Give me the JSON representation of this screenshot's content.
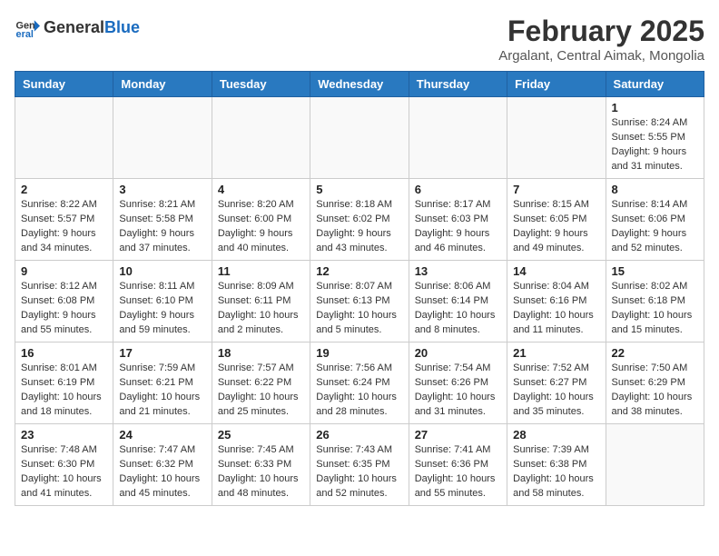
{
  "header": {
    "logo": {
      "general": "General",
      "blue": "Blue"
    },
    "title": "February 2025",
    "subtitle": "Argalant, Central Aimak, Mongolia"
  },
  "weekdays": [
    "Sunday",
    "Monday",
    "Tuesday",
    "Wednesday",
    "Thursday",
    "Friday",
    "Saturday"
  ],
  "weeks": [
    [
      {
        "day": null
      },
      {
        "day": null
      },
      {
        "day": null
      },
      {
        "day": null
      },
      {
        "day": null
      },
      {
        "day": null
      },
      {
        "day": "1",
        "sunrise": "8:24 AM",
        "sunset": "5:55 PM",
        "daylight": "9 hours and 31 minutes."
      }
    ],
    [
      {
        "day": "2",
        "sunrise": "8:22 AM",
        "sunset": "5:57 PM",
        "daylight": "9 hours and 34 minutes."
      },
      {
        "day": "3",
        "sunrise": "8:21 AM",
        "sunset": "5:58 PM",
        "daylight": "9 hours and 37 minutes."
      },
      {
        "day": "4",
        "sunrise": "8:20 AM",
        "sunset": "6:00 PM",
        "daylight": "9 hours and 40 minutes."
      },
      {
        "day": "5",
        "sunrise": "8:18 AM",
        "sunset": "6:02 PM",
        "daylight": "9 hours and 43 minutes."
      },
      {
        "day": "6",
        "sunrise": "8:17 AM",
        "sunset": "6:03 PM",
        "daylight": "9 hours and 46 minutes."
      },
      {
        "day": "7",
        "sunrise": "8:15 AM",
        "sunset": "6:05 PM",
        "daylight": "9 hours and 49 minutes."
      },
      {
        "day": "8",
        "sunrise": "8:14 AM",
        "sunset": "6:06 PM",
        "daylight": "9 hours and 52 minutes."
      }
    ],
    [
      {
        "day": "9",
        "sunrise": "8:12 AM",
        "sunset": "6:08 PM",
        "daylight": "9 hours and 55 minutes."
      },
      {
        "day": "10",
        "sunrise": "8:11 AM",
        "sunset": "6:10 PM",
        "daylight": "9 hours and 59 minutes."
      },
      {
        "day": "11",
        "sunrise": "8:09 AM",
        "sunset": "6:11 PM",
        "daylight": "10 hours and 2 minutes."
      },
      {
        "day": "12",
        "sunrise": "8:07 AM",
        "sunset": "6:13 PM",
        "daylight": "10 hours and 5 minutes."
      },
      {
        "day": "13",
        "sunrise": "8:06 AM",
        "sunset": "6:14 PM",
        "daylight": "10 hours and 8 minutes."
      },
      {
        "day": "14",
        "sunrise": "8:04 AM",
        "sunset": "6:16 PM",
        "daylight": "10 hours and 11 minutes."
      },
      {
        "day": "15",
        "sunrise": "8:02 AM",
        "sunset": "6:18 PM",
        "daylight": "10 hours and 15 minutes."
      }
    ],
    [
      {
        "day": "16",
        "sunrise": "8:01 AM",
        "sunset": "6:19 PM",
        "daylight": "10 hours and 18 minutes."
      },
      {
        "day": "17",
        "sunrise": "7:59 AM",
        "sunset": "6:21 PM",
        "daylight": "10 hours and 21 minutes."
      },
      {
        "day": "18",
        "sunrise": "7:57 AM",
        "sunset": "6:22 PM",
        "daylight": "10 hours and 25 minutes."
      },
      {
        "day": "19",
        "sunrise": "7:56 AM",
        "sunset": "6:24 PM",
        "daylight": "10 hours and 28 minutes."
      },
      {
        "day": "20",
        "sunrise": "7:54 AM",
        "sunset": "6:26 PM",
        "daylight": "10 hours and 31 minutes."
      },
      {
        "day": "21",
        "sunrise": "7:52 AM",
        "sunset": "6:27 PM",
        "daylight": "10 hours and 35 minutes."
      },
      {
        "day": "22",
        "sunrise": "7:50 AM",
        "sunset": "6:29 PM",
        "daylight": "10 hours and 38 minutes."
      }
    ],
    [
      {
        "day": "23",
        "sunrise": "7:48 AM",
        "sunset": "6:30 PM",
        "daylight": "10 hours and 41 minutes."
      },
      {
        "day": "24",
        "sunrise": "7:47 AM",
        "sunset": "6:32 PM",
        "daylight": "10 hours and 45 minutes."
      },
      {
        "day": "25",
        "sunrise": "7:45 AM",
        "sunset": "6:33 PM",
        "daylight": "10 hours and 48 minutes."
      },
      {
        "day": "26",
        "sunrise": "7:43 AM",
        "sunset": "6:35 PM",
        "daylight": "10 hours and 52 minutes."
      },
      {
        "day": "27",
        "sunrise": "7:41 AM",
        "sunset": "6:36 PM",
        "daylight": "10 hours and 55 minutes."
      },
      {
        "day": "28",
        "sunrise": "7:39 AM",
        "sunset": "6:38 PM",
        "daylight": "10 hours and 58 minutes."
      },
      {
        "day": null
      }
    ]
  ]
}
